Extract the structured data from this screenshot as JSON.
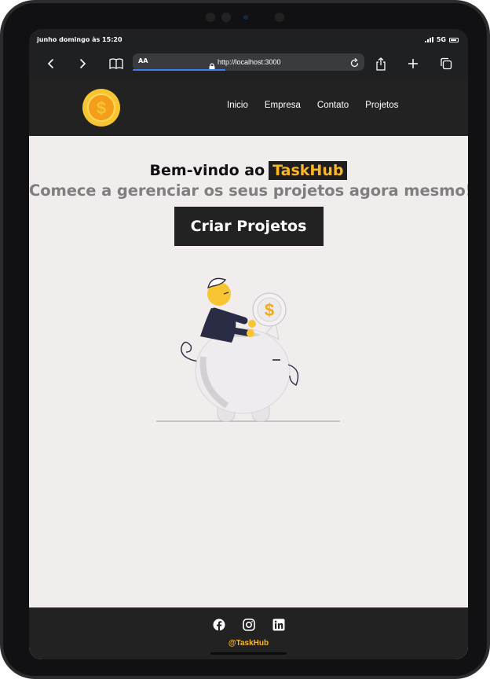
{
  "statusbar": {
    "time": "junho domingo às 15:20",
    "network": "5G"
  },
  "browser": {
    "text_size_label": "AA",
    "url": "http://localhost:3000",
    "page_load_progress": 0.4,
    "icons": {
      "back": "chevron-left-icon",
      "forward": "chevron-right-icon",
      "bookmarks": "book-icon",
      "lock": "lock-icon",
      "reload": "reload-icon",
      "share": "share-icon",
      "new_tab": "plus-icon",
      "tabs": "tabs-icon"
    }
  },
  "header": {
    "logo_icon": "dollar-coin-icon",
    "nav": [
      {
        "label": "Inicio"
      },
      {
        "label": "Empresa"
      },
      {
        "label": "Contato"
      },
      {
        "label": "Projetos"
      }
    ]
  },
  "hero": {
    "title_prefix": "Bem-vindo ao",
    "brand": "TaskHub",
    "subtitle": "Comece a gerenciar os seus projetos agora mesmo!",
    "cta_label": "Criar Projetos",
    "illustration": "person-saving-coin-piggy-bank"
  },
  "footer": {
    "socials": [
      {
        "icon": "facebook-icon"
      },
      {
        "icon": "instagram-icon"
      },
      {
        "icon": "linkedin-icon"
      }
    ],
    "handle": "@TaskHub"
  },
  "colors": {
    "accent": "#f9b625",
    "header_bg": "#222223",
    "page_bg": "#f1eded",
    "subtitle": "#7f7f7f"
  }
}
